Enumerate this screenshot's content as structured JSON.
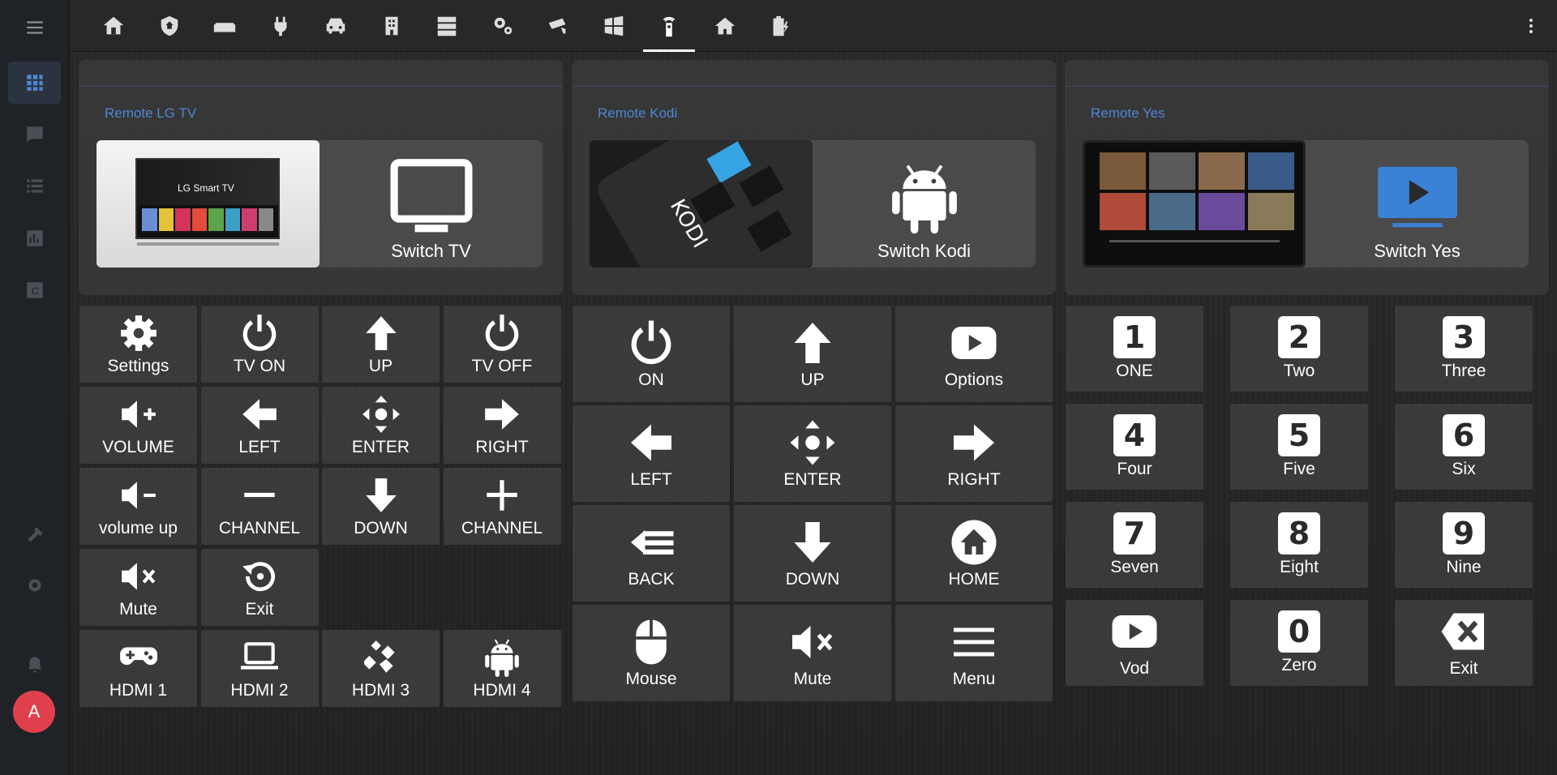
{
  "topbar": {
    "tabs": [
      {
        "icon": "home-assistant-icon"
      },
      {
        "icon": "security-shield-icon"
      },
      {
        "icon": "sofa-icon"
      },
      {
        "icon": "power-plug-icon"
      },
      {
        "icon": "car-icon"
      },
      {
        "icon": "building-icon"
      },
      {
        "icon": "server-icon"
      },
      {
        "icon": "gears-icon"
      },
      {
        "icon": "cctv-icon"
      },
      {
        "icon": "windows-icon"
      },
      {
        "icon": "remote-icon",
        "active": true
      },
      {
        "icon": "house-icon"
      },
      {
        "icon": "battery-charging-icon"
      }
    ]
  },
  "sidebar": {
    "items": [
      "grid-icon",
      "chat-icon",
      "list-icon",
      "chart-icon",
      "box-icon",
      "hammer-icon",
      "gear-icon",
      "bell-icon"
    ],
    "avatar_letter": "A"
  },
  "cards": {
    "lg": {
      "title": "Remote LG TV",
      "switch_label": "Switch TV",
      "image_text": "LG Smart TV"
    },
    "kodi": {
      "title": "Remote Kodi",
      "switch_label": "Switch Kodi",
      "image_text": "KODI"
    },
    "yes": {
      "title": "Remote Yes",
      "switch_label": "Switch Yes"
    }
  },
  "lg_buttons": [
    {
      "label": "Settings",
      "icon": "gear-icon"
    },
    {
      "label": "TV ON",
      "icon": "power-icon"
    },
    {
      "label": "UP",
      "icon": "arrow-up-icon"
    },
    {
      "label": "TV OFF",
      "icon": "power-icon"
    },
    {
      "label": "VOLUME",
      "icon": "volume-plus-icon"
    },
    {
      "label": "LEFT",
      "icon": "arrow-left-icon"
    },
    {
      "label": "ENTER",
      "icon": "dpad-icon"
    },
    {
      "label": "RIGHT",
      "icon": "arrow-right-icon"
    },
    {
      "label": "volume up",
      "icon": "volume-minus-icon"
    },
    {
      "label": "CHANNEL",
      "icon": "minus-icon"
    },
    {
      "label": "DOWN",
      "icon": "arrow-down-icon"
    },
    {
      "label": "CHANNEL",
      "icon": "plus-icon"
    },
    {
      "label": "Mute",
      "icon": "volume-mute-icon"
    },
    {
      "label": "Exit",
      "icon": "restore-icon"
    },
    {
      "label": "HDMI 1",
      "icon": "gamepad-icon"
    },
    {
      "label": "HDMI 2",
      "icon": "laptop-icon"
    },
    {
      "label": "HDMI 3",
      "icon": "kodi-icon"
    },
    {
      "label": "HDMI 4",
      "icon": "android-icon"
    }
  ],
  "kodi_buttons": [
    {
      "label": "ON",
      "icon": "power-icon"
    },
    {
      "label": "UP",
      "icon": "arrow-up-icon"
    },
    {
      "label": "Options",
      "icon": "youtube-icon"
    },
    {
      "label": "LEFT",
      "icon": "arrow-left-icon"
    },
    {
      "label": "ENTER",
      "icon": "dpad-icon"
    },
    {
      "label": "RIGHT",
      "icon": "arrow-right-icon"
    },
    {
      "label": "BACK",
      "icon": "back-icon"
    },
    {
      "label": "DOWN",
      "icon": "arrow-down-icon"
    },
    {
      "label": "HOME",
      "icon": "home-circle-icon"
    },
    {
      "label": "Mouse",
      "icon": "mouse-icon"
    },
    {
      "label": "Mute",
      "icon": "volume-mute-icon"
    },
    {
      "label": "Menu",
      "icon": "menu-icon"
    }
  ],
  "yes_buttons": [
    {
      "label": "ONE",
      "digit": "1"
    },
    {
      "label": "Two",
      "digit": "2"
    },
    {
      "label": "Three",
      "digit": "3"
    },
    {
      "label": "Four",
      "digit": "4"
    },
    {
      "label": "Five",
      "digit": "5"
    },
    {
      "label": "Six",
      "digit": "6"
    },
    {
      "label": "Seven",
      "digit": "7"
    },
    {
      "label": "Eight",
      "digit": "8"
    },
    {
      "label": "Nine",
      "digit": "9"
    },
    {
      "label": "Vod",
      "icon": "youtube-icon"
    },
    {
      "label": "Zero",
      "digit": "0"
    },
    {
      "label": "Exit",
      "icon": "backspace-icon"
    }
  ]
}
